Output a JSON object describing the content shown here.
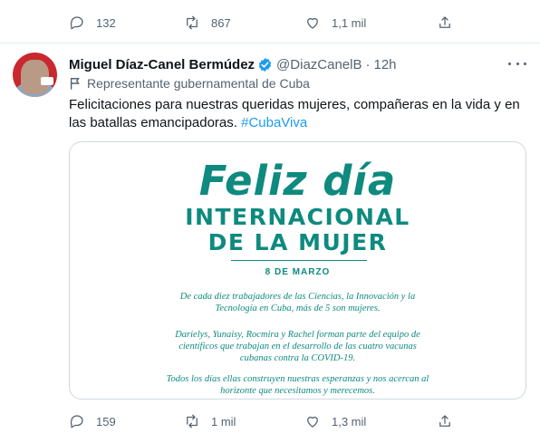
{
  "prev_tweet": {
    "reply_count": "132",
    "retweet_count": "867",
    "like_count": "1,1 mil"
  },
  "tweet": {
    "author_name": "Miguel Díaz-Canel Bermúdez",
    "handle": "@DiazCanelB",
    "separator": "·",
    "time": "12h",
    "label": "Representante gubernamental de Cuba",
    "text": "Felicitaciones para nuestras queridas mujeres, compañeras en la vida y en las batallas emancipadoras. ",
    "hashtag": "#CubaViva",
    "image": {
      "title_line1": "Feliz día",
      "title_line2": "INTERNACIONAL",
      "title_line3": "DE LA MUJER",
      "date": "8 DE MARZO",
      "paragraph1": "De cada diez trabajadores de las Ciencias, la Innovación y la Tecnología en Cuba, más de 5 son mujeres.",
      "paragraph2": "Darielys, Yunaisy, Rocmira y Rachel forman parte del equipo de científicos que trabajan en el desarrollo de las cuatro vacunas cubanas contra la COVID-19.",
      "paragraph3": "Todos los días ellas construyen nuestras esperanzas y nos acercan al horizonte que necesitamos y merecemos."
    },
    "reply_count": "159",
    "retweet_count": "1 mil",
    "like_count": "1,3 mil"
  },
  "colors": {
    "accent": "#1d9bf0",
    "muted": "#536471",
    "card_teal": "#0e8a7f"
  }
}
